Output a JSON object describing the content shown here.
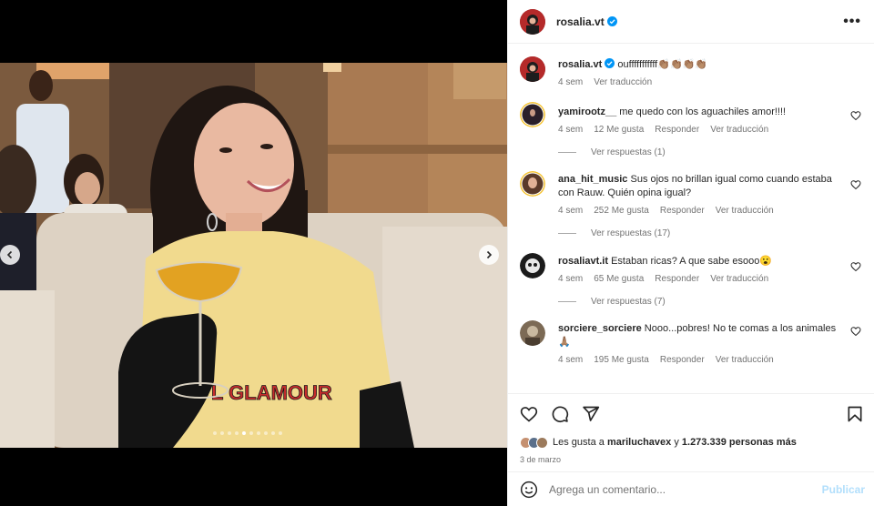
{
  "header": {
    "username": "rosalia.vt",
    "avatar_icon": "profile-avatar"
  },
  "media": {
    "icons": {
      "prev": "chevron-left-icon",
      "next": "chevron-right-icon"
    },
    "total_slides": 10,
    "active_slide": 4,
    "shirt_text": "L GLAMOUR"
  },
  "caption": {
    "username": "rosalia.vt",
    "text": "oufffffffffff",
    "emojis": "👏🏽👏🏽👏🏽👏🏽",
    "time": "4 sem",
    "translate": "Ver traducción"
  },
  "comments": [
    {
      "username": "yamirootz__",
      "text": "me quedo con los aguachiles amor!!!!",
      "time": "4 sem",
      "likes": "12 Me gusta",
      "reply": "Responder",
      "translate": "Ver traducción",
      "replies": "Ver respuestas (1)"
    },
    {
      "username": "ana_hit_music",
      "text": "Sus ojos no brillan igual como cuando estaba con Rauw. Quién opina igual?",
      "time": "4 sem",
      "likes": "252 Me gusta",
      "reply": "Responder",
      "translate": "Ver traducción",
      "replies": "Ver respuestas (17)"
    },
    {
      "username": "rosaliavt.it",
      "text": "Estaban ricas? A que sabe esooo😮",
      "time": "4 sem",
      "likes": "65 Me gusta",
      "reply": "Responder",
      "translate": "Ver traducción",
      "replies": "Ver respuestas (7)"
    },
    {
      "username": "sorciere_sorciere",
      "text": "Nooo...pobres! No te comas a los animales 🙏🏽",
      "time": "4 sem",
      "likes": "195 Me gusta",
      "reply": "Responder",
      "translate": "Ver traducción"
    }
  ],
  "actions": {
    "like": "heart-icon",
    "comment": "comment-icon",
    "share": "send-icon",
    "save": "bookmark-icon"
  },
  "likes": {
    "prefix": "Les gusta a",
    "user": "mariluchavex",
    "conj": "y",
    "count": "1.273.339 personas más"
  },
  "date": "3 de marzo",
  "add_comment": {
    "placeholder": "Agrega un comentario...",
    "post": "Publicar"
  },
  "colors": {
    "accent_blue": "#0095f6",
    "post_disabled": "#b2dffc",
    "secondary_text": "#737373"
  }
}
